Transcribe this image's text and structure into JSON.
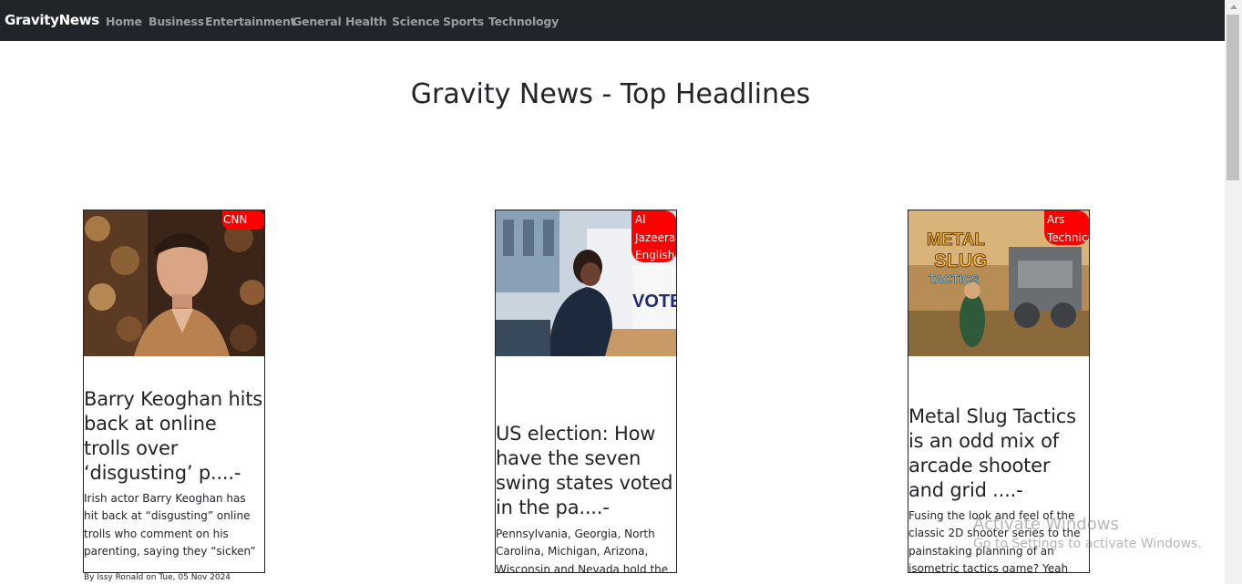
{
  "nav": {
    "brand": "GravityNews",
    "links": [
      "Home",
      "Business",
      "Entertainment",
      "General",
      "Health",
      "Science",
      "Sports",
      "Technology"
    ]
  },
  "page_title": "Gravity News - Top Headlines",
  "cards": [
    {
      "source": "CNN",
      "title": "Barry Keoghan hits back at online trolls over ‘disgusting’ p....-",
      "description": "Irish actor Barry Keoghan has hit back at “disgusting” online trolls who comment on his parenting, saying they “sicken”",
      "byline": "By Issy Ronald on Tue, 05 Nov 2024"
    },
    {
      "source": "Al Jazeera English",
      "title": "US election: How have the seven swing states voted in the pa....-",
      "description": "Pennsylvania, Georgia, North Carolina, Michigan, Arizona, Wisconsin and Nevada hold the keys to the White House.",
      "image_text": "VOTE"
    },
    {
      "source": "Ars Technica",
      "title": "Metal Slug Tactics is an odd mix of arcade shooter and grid ....-",
      "description": "Fusing the look and feel of the classic 2D shooter series to the painstaking planning of an isometric tactics game? Yeah",
      "image_text": [
        "METAL",
        "SLUG",
        "TACTICS"
      ]
    }
  ],
  "watermark": {
    "line1": "Activate Windows",
    "line2": "Go to Settings to activate Windows."
  },
  "colors": {
    "navbar": "#212529",
    "badge": "#ff0000",
    "nav_link": "#9a9da0"
  }
}
